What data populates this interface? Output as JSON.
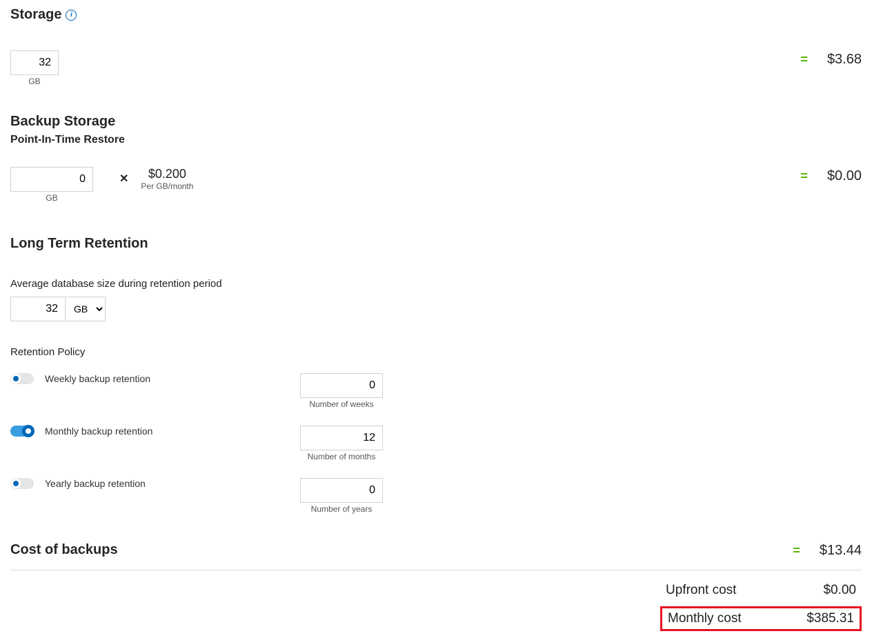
{
  "storage": {
    "title": "Storage",
    "value": "32",
    "unit": "GB",
    "eq": "=",
    "price": "$3.68"
  },
  "backup": {
    "title": "Backup Storage",
    "subtitle": "Point-In-Time Restore",
    "value": "0",
    "unit": "GB",
    "mult": "✕",
    "rate": "$0.200",
    "rate_label": "Per GB/month",
    "eq": "=",
    "price": "$0.00"
  },
  "ltr": {
    "title": "Long Term Retention",
    "avg_label": "Average database size during retention period",
    "avg_value": "32",
    "avg_unit": "GB",
    "policy_label": "Retention Policy",
    "weekly": {
      "label": "Weekly backup retention",
      "value": "0",
      "sublabel": "Number of weeks"
    },
    "monthly": {
      "label": "Monthly backup retention",
      "value": "12",
      "sublabel": "Number of months"
    },
    "yearly": {
      "label": "Yearly backup retention",
      "value": "0",
      "sublabel": "Number of years"
    }
  },
  "cost_backups": {
    "title": "Cost of backups",
    "eq": "=",
    "price": "$13.44"
  },
  "summary": {
    "upfront_label": "Upfront cost",
    "upfront_value": "$0.00",
    "monthly_label": "Monthly cost",
    "monthly_value": "$385.31"
  }
}
